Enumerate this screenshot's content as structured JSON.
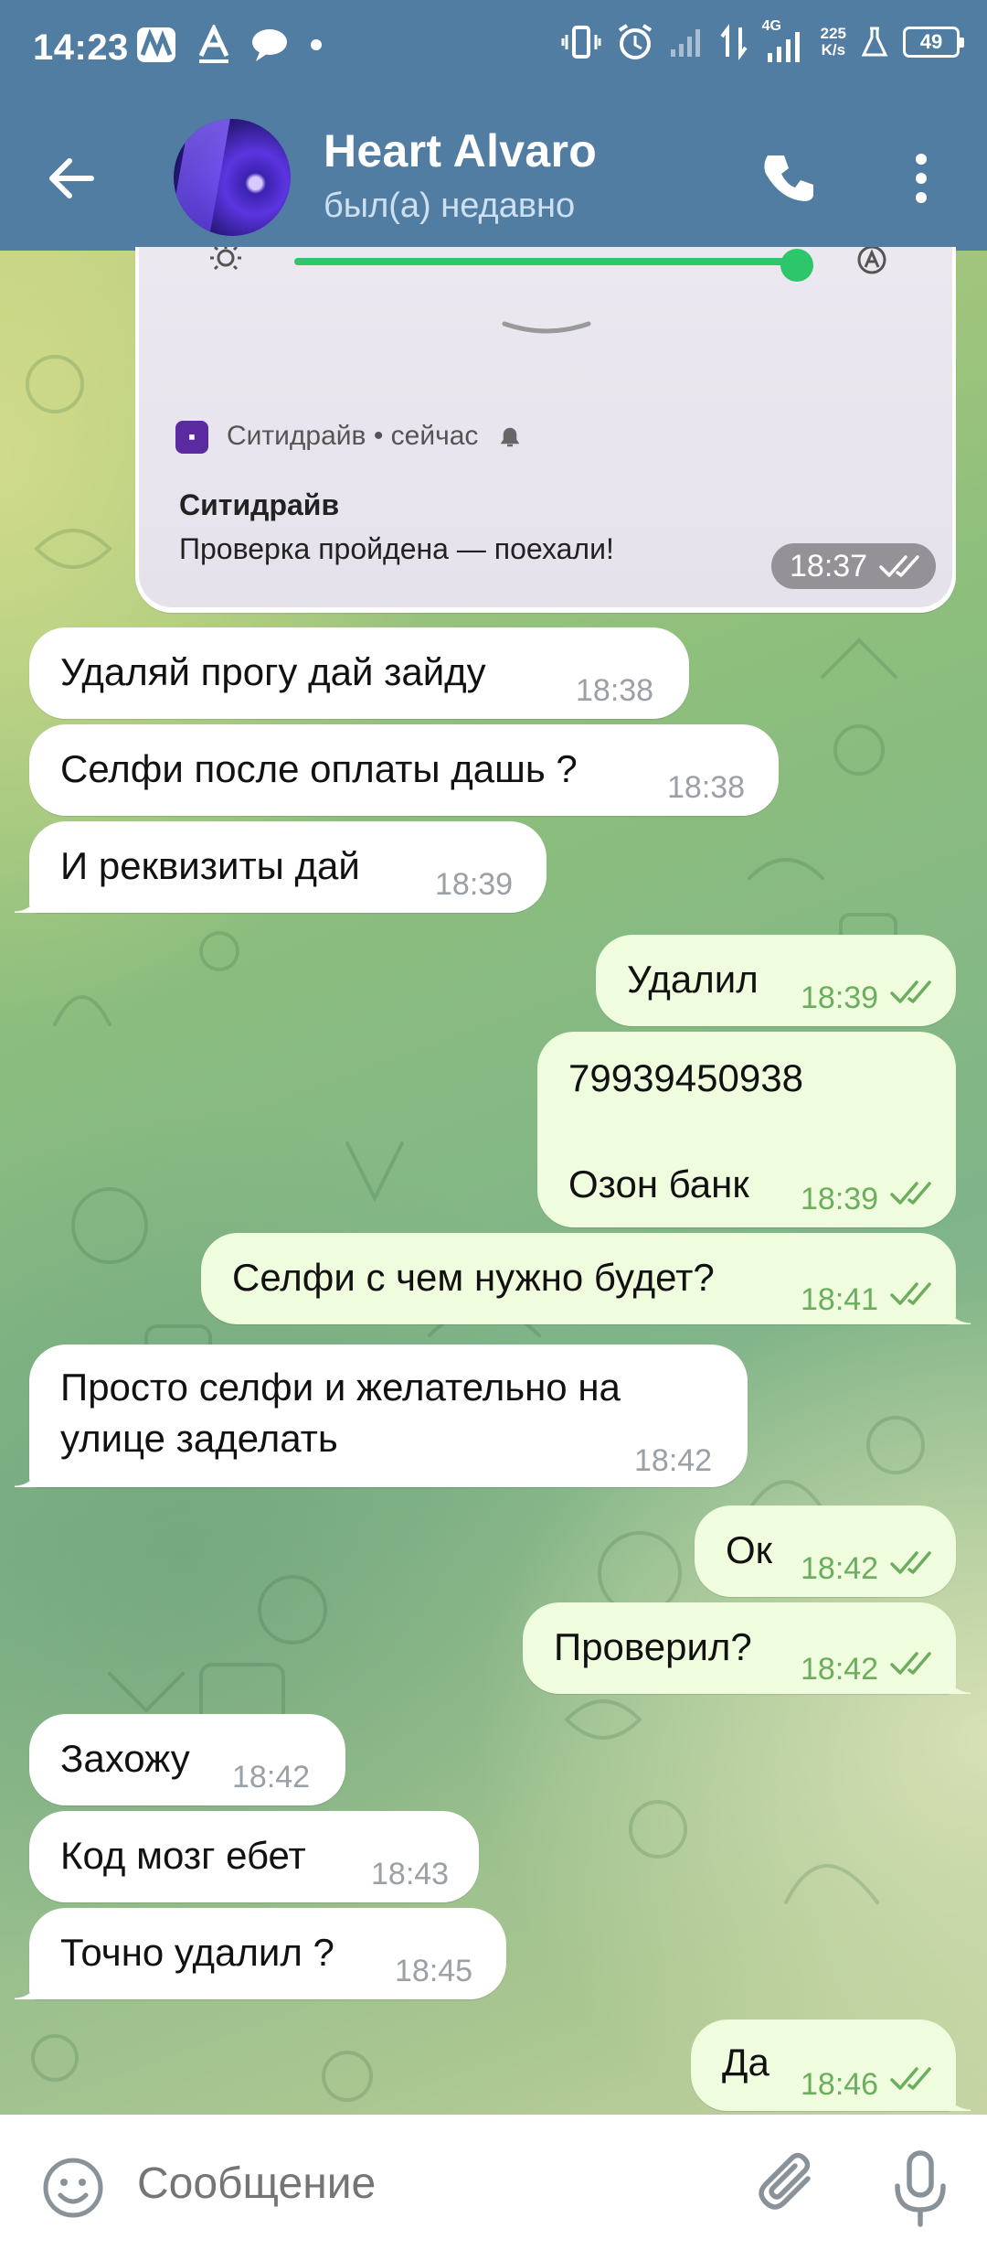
{
  "status_bar": {
    "time": "14:23",
    "network_type": "4G",
    "speed_value": "225",
    "speed_unit": "K/s",
    "battery": "49"
  },
  "header": {
    "contact_name": "Heart Alvaro",
    "contact_status": "был(а) недавно"
  },
  "screenshot_message": {
    "notification_app": "Ситидрайв • сейчас",
    "notification_title": "Ситидрайв",
    "notification_body": "Проверка пройдена — поехали!",
    "time": "18:37"
  },
  "messages": [
    {
      "direction": "in",
      "text": "Удаляй прогу дай зайду",
      "time": "18:38"
    },
    {
      "direction": "in",
      "text": "Селфи после оплаты дашь ?",
      "time": "18:38"
    },
    {
      "direction": "in",
      "text": "И реквизиты дай",
      "time": "18:39"
    },
    {
      "direction": "out",
      "text": "Удалил",
      "time": "18:39"
    },
    {
      "direction": "out",
      "line1": "79939450938",
      "line2": "Озон банк",
      "time": "18:39"
    },
    {
      "direction": "out",
      "text": "Селфи с чем нужно будет?",
      "time": "18:41"
    },
    {
      "direction": "in",
      "line1": "Просто селфи и желательно на",
      "line2": "улице заделать",
      "time": "18:42"
    },
    {
      "direction": "out",
      "text": "Ок",
      "time": "18:42"
    },
    {
      "direction": "out",
      "text": "Проверил?",
      "time": "18:42"
    },
    {
      "direction": "in",
      "text": "Захожу",
      "time": "18:42"
    },
    {
      "direction": "in",
      "text": "Код мозг ебет",
      "time": "18:43"
    },
    {
      "direction": "in",
      "text": "Точно удалил ?",
      "time": "18:45"
    },
    {
      "direction": "out",
      "text": "Да",
      "time": "18:46"
    }
  ],
  "composer": {
    "placeholder": "Сообщение"
  },
  "colors": {
    "header_bg": "#527da3",
    "incoming_bubble": "#ffffff",
    "outgoing_bubble": "#effdde",
    "outgoing_time": "#6cae5e"
  }
}
